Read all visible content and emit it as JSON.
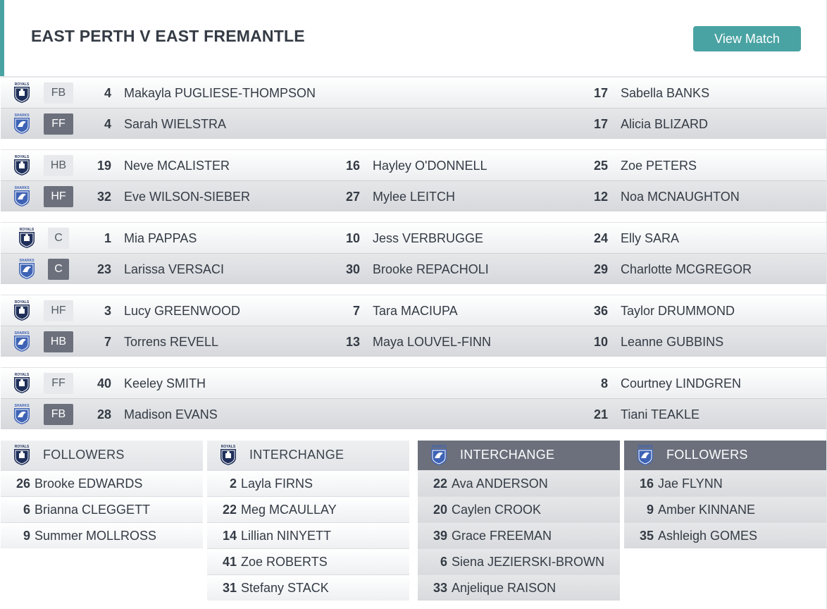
{
  "header": {
    "title": "EAST PERTH V EAST FREMANTLE",
    "view_label": "View Match"
  },
  "teams": {
    "home_logo_text": "ROYALS",
    "away_logo_text": "SHARKS"
  },
  "lines": [
    {
      "home": {
        "pos": "FB",
        "players": [
          {
            "num": "4",
            "name": "Makayla PUGLIESE-THOMPSON"
          },
          null,
          {
            "num": "17",
            "name": "Sabella BANKS"
          }
        ]
      },
      "away": {
        "pos": "FF",
        "players": [
          {
            "num": "4",
            "name": "Sarah WIELSTRA"
          },
          null,
          {
            "num": "17",
            "name": "Alicia BLIZARD"
          }
        ]
      }
    },
    {
      "home": {
        "pos": "HB",
        "players": [
          {
            "num": "19",
            "name": "Neve MCALISTER"
          },
          {
            "num": "16",
            "name": "Hayley O'DONNELL"
          },
          {
            "num": "25",
            "name": "Zoe PETERS"
          }
        ]
      },
      "away": {
        "pos": "HF",
        "players": [
          {
            "num": "32",
            "name": "Eve WILSON-SIEBER"
          },
          {
            "num": "27",
            "name": "Mylee LEITCH"
          },
          {
            "num": "12",
            "name": "Noa MCNAUGHTON"
          }
        ]
      }
    },
    {
      "home": {
        "pos": "C",
        "players": [
          {
            "num": "1",
            "name": "Mia PAPPAS"
          },
          {
            "num": "10",
            "name": "Jess VERBRUGGE"
          },
          {
            "num": "24",
            "name": "Elly SARA"
          }
        ]
      },
      "away": {
        "pos": "C",
        "players": [
          {
            "num": "23",
            "name": "Larissa VERSACI"
          },
          {
            "num": "30",
            "name": "Brooke REPACHOLI"
          },
          {
            "num": "29",
            "name": "Charlotte MCGREGOR"
          }
        ]
      }
    },
    {
      "home": {
        "pos": "HF",
        "players": [
          {
            "num": "3",
            "name": "Lucy GREENWOOD"
          },
          {
            "num": "7",
            "name": "Tara MACIUPA"
          },
          {
            "num": "36",
            "name": "Taylor DRUMMOND"
          }
        ]
      },
      "away": {
        "pos": "HB",
        "players": [
          {
            "num": "7",
            "name": "Torrens REVELL"
          },
          {
            "num": "13",
            "name": "Maya LOUVEL-FINN"
          },
          {
            "num": "10",
            "name": "Leanne GUBBINS"
          }
        ]
      }
    },
    {
      "home": {
        "pos": "FF",
        "players": [
          {
            "num": "40",
            "name": "Keeley SMITH"
          },
          null,
          {
            "num": "8",
            "name": "Courtney LINDGREN"
          }
        ]
      },
      "away": {
        "pos": "FB",
        "players": [
          {
            "num": "28",
            "name": "Madison EVANS"
          },
          null,
          {
            "num": "21",
            "name": "Tiani TEAKLE"
          }
        ]
      }
    }
  ],
  "panels": [
    {
      "team": "home",
      "title": "FOLLOWERS",
      "players": [
        {
          "num": "26",
          "name": "Brooke EDWARDS"
        },
        {
          "num": "6",
          "name": "Brianna CLEGGETT"
        },
        {
          "num": "9",
          "name": "Summer MOLLROSS"
        }
      ]
    },
    {
      "team": "home",
      "title": "INTERCHANGE",
      "players": [
        {
          "num": "2",
          "name": "Layla FIRNS"
        },
        {
          "num": "22",
          "name": "Meg MCAULLAY"
        },
        {
          "num": "14",
          "name": "Lillian NINYETT"
        },
        {
          "num": "41",
          "name": "Zoe ROBERTS"
        },
        {
          "num": "31",
          "name": "Stefany STACK"
        }
      ]
    },
    {
      "team": "away",
      "title": "INTERCHANGE",
      "players": [
        {
          "num": "22",
          "name": "Ava ANDERSON"
        },
        {
          "num": "20",
          "name": "Caylen CROOK"
        },
        {
          "num": "39",
          "name": "Grace FREEMAN"
        },
        {
          "num": "6",
          "name": "Siena JEZIERSKI-BROWN"
        },
        {
          "num": "33",
          "name": "Anjelique RAISON"
        }
      ]
    },
    {
      "team": "away",
      "title": "FOLLOWERS",
      "players": [
        {
          "num": "16",
          "name": "Jae FLYNN"
        },
        {
          "num": "9",
          "name": "Amber KINNANE"
        },
        {
          "num": "35",
          "name": "Ashleigh GOMES"
        }
      ]
    }
  ],
  "colors": {
    "accent": "#4aa3a3",
    "away_badge": "#6b707c",
    "home_shield": "#1f2f5a",
    "away_shield": "#3e63b5"
  }
}
